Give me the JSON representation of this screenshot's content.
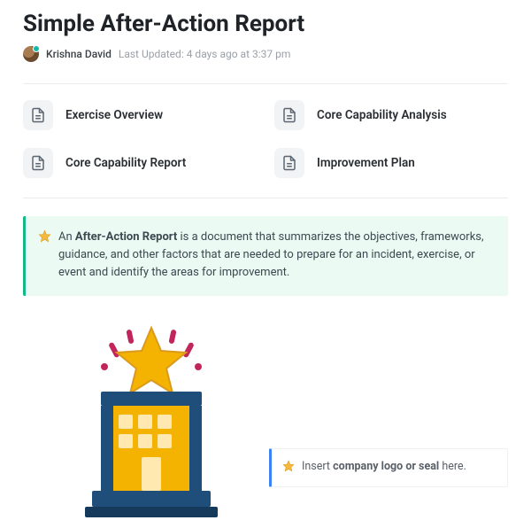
{
  "title": "Simple After-Action Report",
  "byline": {
    "author": "Krishna David",
    "updated": "Last Updated: 4 days ago at 3:37 pm"
  },
  "sections": [
    {
      "label": "Exercise Overview"
    },
    {
      "label": "Core Capability Analysis"
    },
    {
      "label": "Core Capability Report"
    },
    {
      "label": "Improvement Plan"
    }
  ],
  "definition": {
    "prefix": "An ",
    "bold": "After-Action Report",
    "rest": " is a document that summarizes the objectives, frameworks, guidance, and other factors that are needed to prepare for an incident, exercise, or event and identify the areas for improvement."
  },
  "logo_hint": {
    "prefix": "Insert ",
    "bold": "company logo or seal",
    "rest": " here."
  }
}
